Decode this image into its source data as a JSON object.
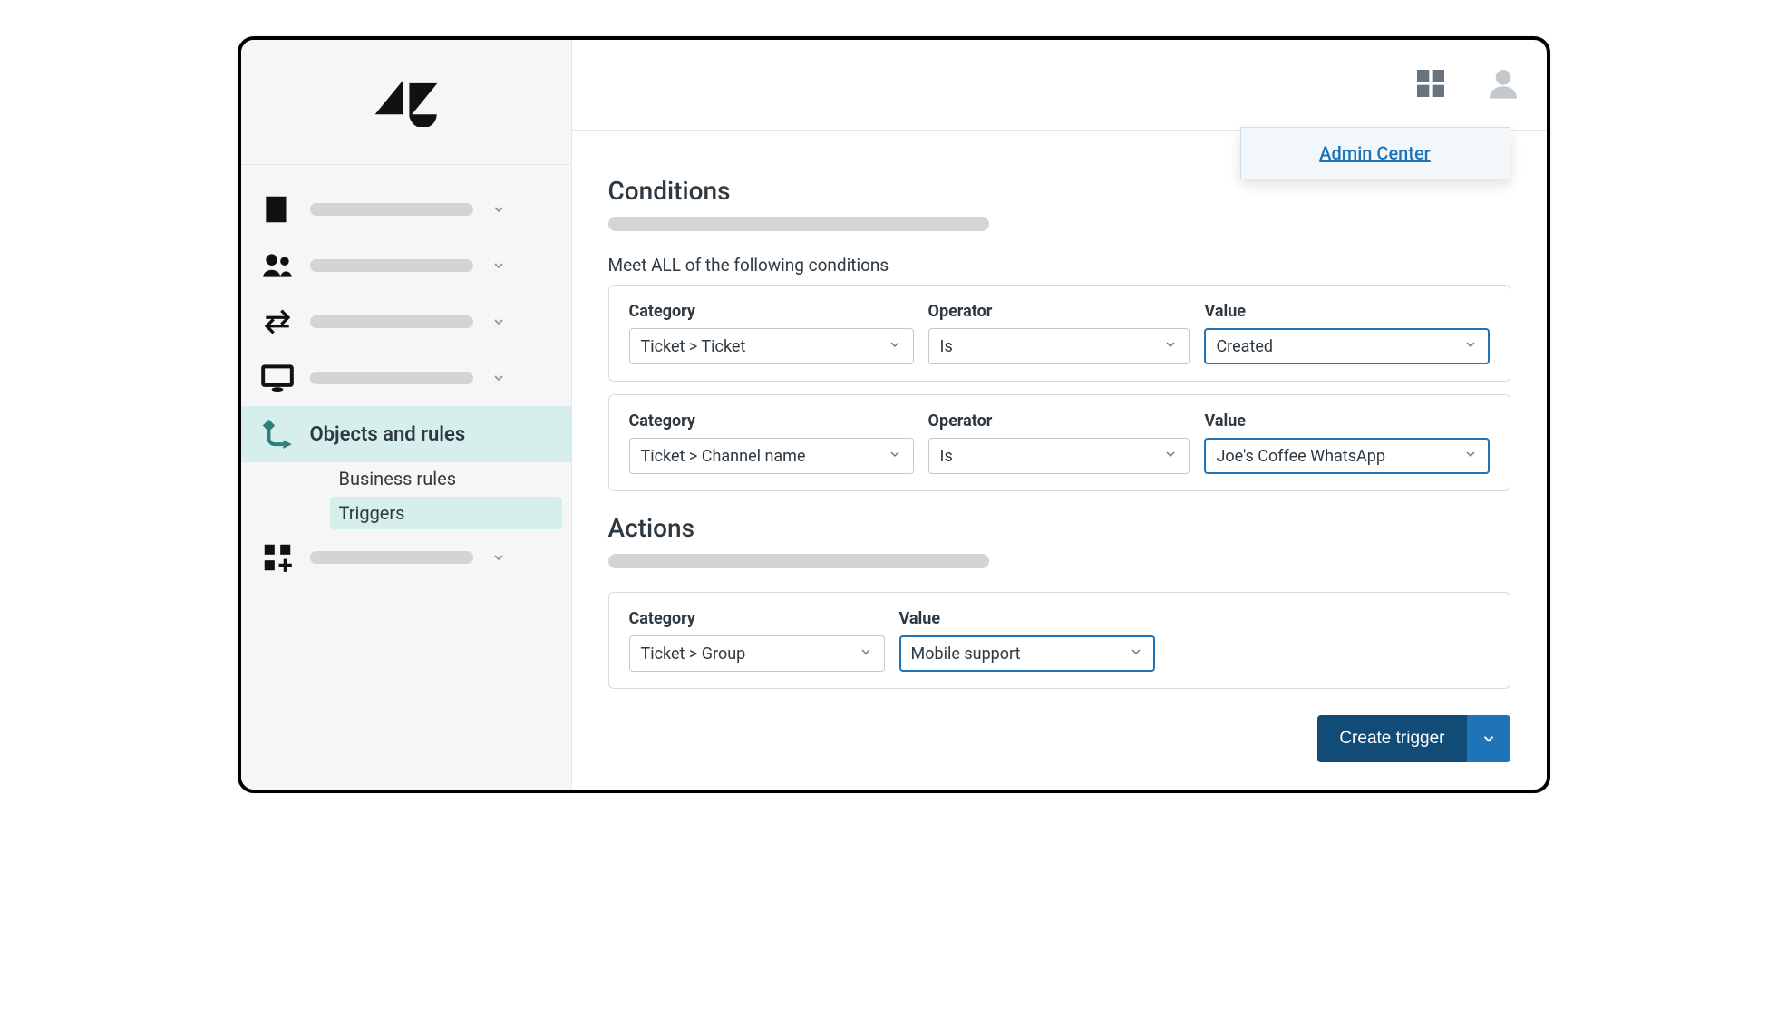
{
  "header": {
    "dropdown_link": "Admin Center"
  },
  "sidebar": {
    "active_label": "Objects and rules",
    "sub_items": [
      "Business rules",
      "Triggers"
    ]
  },
  "conditions": {
    "title": "Conditions",
    "meet_all": "Meet ALL of the following conditions",
    "labels": {
      "category": "Category",
      "operator": "Operator",
      "value": "Value"
    },
    "rows": [
      {
        "category": "Ticket > Ticket",
        "operator": "Is",
        "value": "Created"
      },
      {
        "category": "Ticket > Channel name",
        "operator": "Is",
        "value": "Joe's Coffee WhatsApp"
      }
    ]
  },
  "actions": {
    "title": "Actions",
    "labels": {
      "category": "Category",
      "value": "Value"
    },
    "rows": [
      {
        "category": "Ticket > Group",
        "value": "Mobile support"
      }
    ]
  },
  "footer": {
    "create_label": "Create trigger"
  }
}
